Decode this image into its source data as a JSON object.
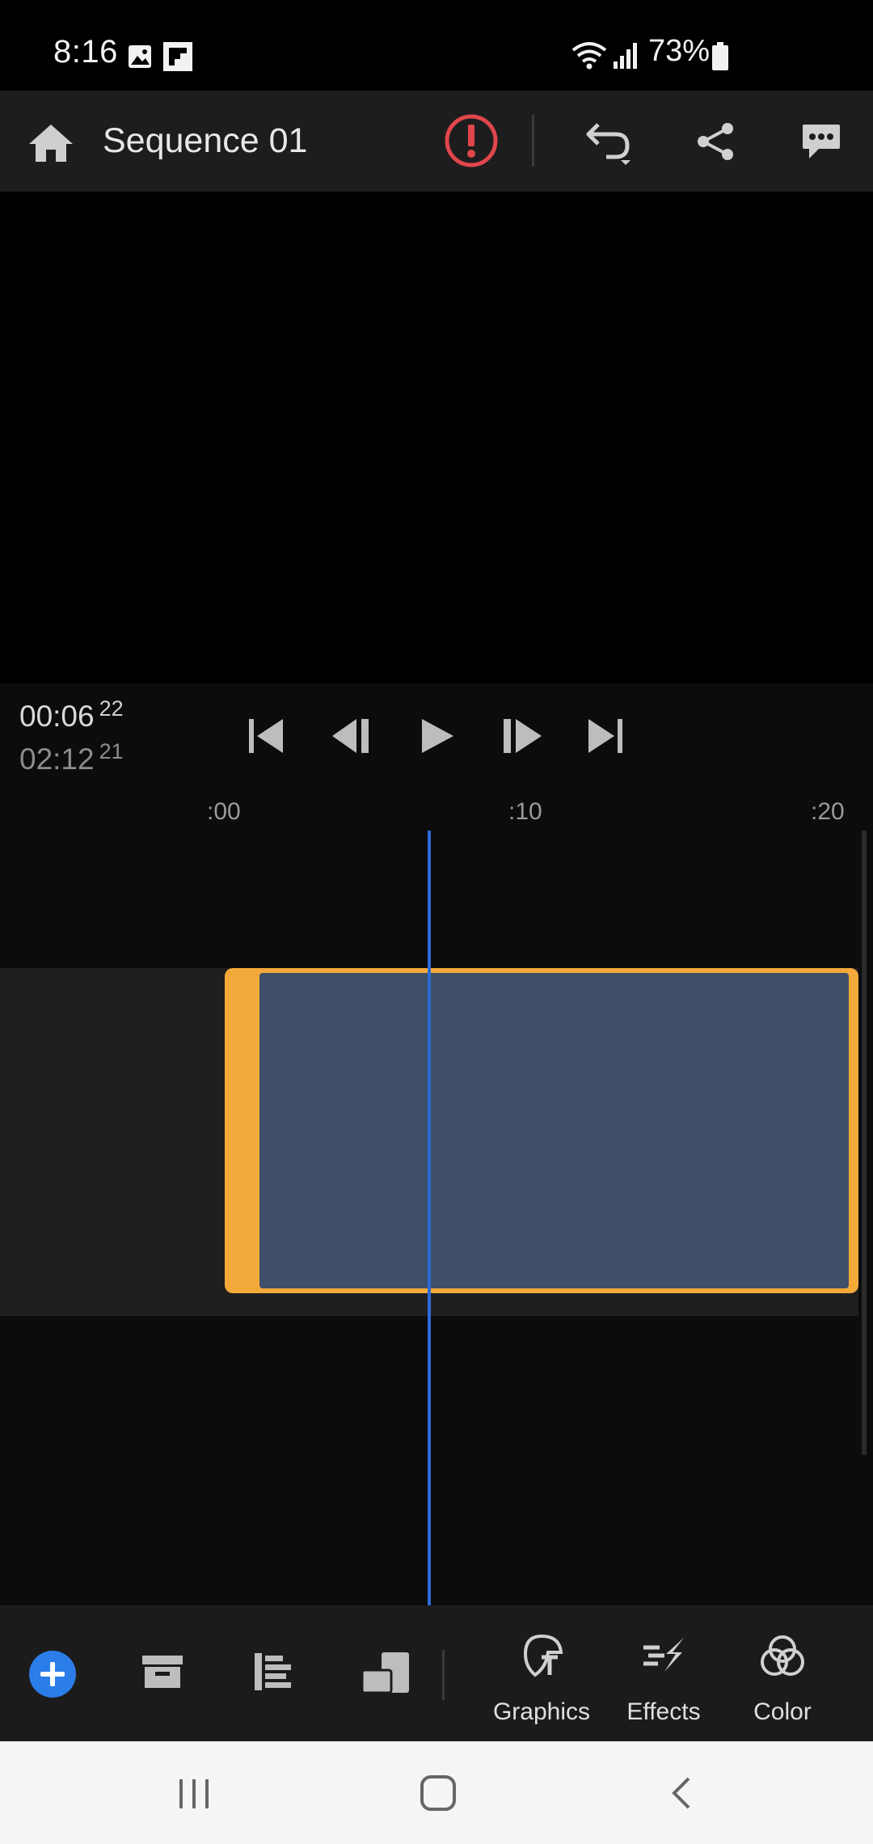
{
  "status_bar": {
    "time": "8:16",
    "battery": "73%",
    "icons": [
      "gallery-icon",
      "flipboard-icon",
      "wifi-icon",
      "signal-icon",
      "battery-icon"
    ]
  },
  "header": {
    "title": "Sequence 01",
    "icons": [
      "home-icon",
      "warning-icon",
      "undo-icon",
      "share-icon",
      "comment-icon"
    ],
    "warning_color": "#e0464b"
  },
  "transport": {
    "current_time": "00:06",
    "current_frames": "22",
    "duration_time": "02:12",
    "duration_frames": "21",
    "controls": [
      "skip-to-start-icon",
      "step-back-icon",
      "play-icon",
      "step-forward-icon",
      "skip-to-end-icon"
    ]
  },
  "ruler": {
    "marks": [
      ":00",
      ":10",
      ":20"
    ]
  },
  "timeline": {
    "clip_color": "#f3a93a",
    "clip_body_color": "#3e4f67",
    "playhead_color": "#2d6bd6"
  },
  "bottom_toolbar": {
    "add_color": "#2b7de9",
    "tools": [
      {
        "label": "Graphics",
        "icon": "graphics-icon"
      },
      {
        "label": "Effects",
        "icon": "effects-icon"
      },
      {
        "label": "Color",
        "icon": "color-icon"
      }
    ]
  },
  "nav_bar": {
    "icons": [
      "recents-icon",
      "home-nav-icon",
      "back-icon"
    ]
  }
}
